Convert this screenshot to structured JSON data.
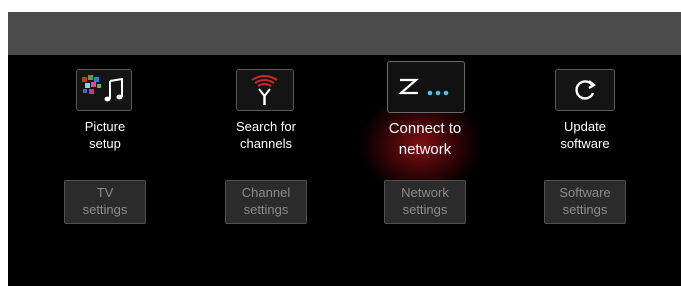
{
  "menu": {
    "items": [
      {
        "id": "picture",
        "label_line1": "Picture",
        "label_line2": "setup",
        "icon": "picture-music-icon"
      },
      {
        "id": "channels",
        "label_line1": "Search for",
        "label_line2": "channels",
        "icon": "antenna-icon"
      },
      {
        "id": "network",
        "label_line1": "Connect to",
        "label_line2": "network",
        "icon": "network-icon",
        "selected": true,
        "icon_text": "Z..."
      },
      {
        "id": "software",
        "label_line1": "Update",
        "label_line2": "software",
        "icon": "refresh-icon"
      }
    ],
    "settings_buttons": [
      {
        "line1": "TV",
        "line2": "settings"
      },
      {
        "line1": "Channel",
        "line2": "settings"
      },
      {
        "line1": "Network",
        "line2": "settings"
      },
      {
        "line1": "Software",
        "line2": "settings"
      }
    ]
  },
  "colors": {
    "background": "#000000",
    "header": "#4b4b4b",
    "highlight": "#aa1419",
    "network_dots": "#4fc3e8"
  }
}
